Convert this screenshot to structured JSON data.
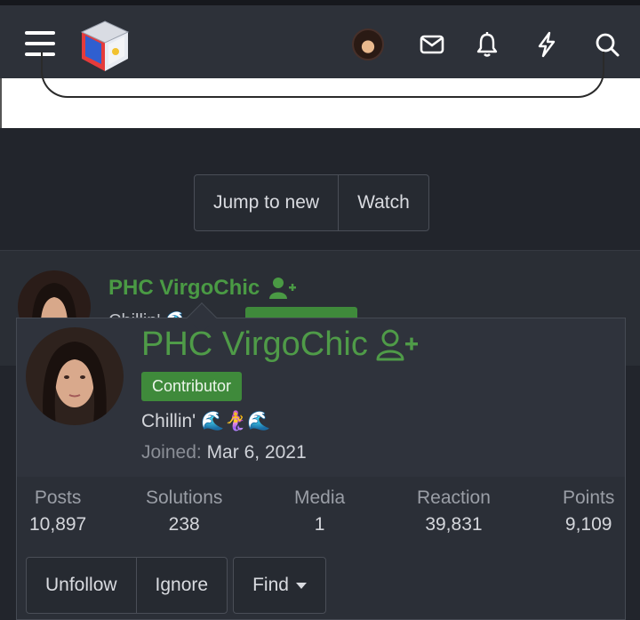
{
  "header": {
    "icons": [
      "menu-icon",
      "logo",
      "user-avatar",
      "inbox-icon",
      "alerts-icon",
      "whats-new-icon",
      "search-icon"
    ]
  },
  "thread_actions": {
    "jump_label": "Jump to new",
    "watch_label": "Watch"
  },
  "post": {
    "username": "PHC VirgoChic",
    "status": "Chillin' 🌊 🌊"
  },
  "member_card": {
    "username": "PHC VirgoChic",
    "badge": "Contributor",
    "status": "Chillin' 🌊🧜‍♀️🌊",
    "joined_label": "Joined:",
    "joined_date": "Mar 6, 2021",
    "stats": [
      {
        "label": "Posts",
        "value": "10,897"
      },
      {
        "label": "Solutions",
        "value": "238"
      },
      {
        "label": "Media",
        "value": "1"
      },
      {
        "label": "Reaction",
        "value": "39,831"
      },
      {
        "label": "Points",
        "value": "9,109"
      }
    ],
    "unfollow_label": "Unfollow",
    "ignore_label": "Ignore",
    "find_label": "Find"
  },
  "colors": {
    "accent_green": "#4f9b48",
    "badge_green": "#3f8a3b",
    "background": "#22252c"
  }
}
